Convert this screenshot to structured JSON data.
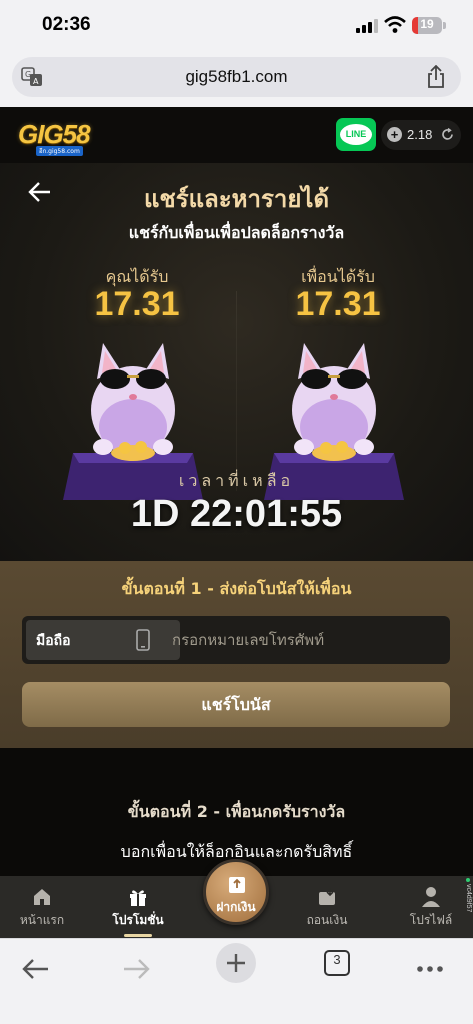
{
  "status_bar": {
    "time": "02:36",
    "battery": "19",
    "battery_level": 0.19
  },
  "browser": {
    "url": "gig58fb1.com",
    "tabs_count": "3"
  },
  "site": {
    "logo": "GIG58",
    "logo_sub": "อีก.gig58.com",
    "line_label": "LINE",
    "balance": "2.18"
  },
  "hero": {
    "title": "แชร์และหารายได้",
    "subtitle": "แชร์กับเพื่อนเพื่อปลดล็อกรางวัล",
    "you_label": "คุณได้รับ",
    "you_value": "17.31",
    "friend_label": "เพื่อนได้รับ",
    "friend_value": "17.31",
    "timer_label": "เวลาที่เหลือ",
    "timer": "1D 22:01:55"
  },
  "step1": {
    "title": "ขั้นตอนที่ 1 - ส่งต่อโบนัสให้เพื่อน",
    "phone_prefix": "มือถือ",
    "phone_placeholder": "กรอกหมายเลขโทรศัพท์",
    "share_button": "แชร์โบนัส"
  },
  "step2": {
    "title": "ขั้นตอนที่ 2 - เพื่อนกดรับรางวัล",
    "description": "บอกเพื่อนให้ล็อกอินและกดรับสิทธิ์"
  },
  "nav": {
    "home": "หน้าแรก",
    "promotions": "โปรโมชั่น",
    "deposit": "ฝากเงิน",
    "withdraw": "ถอนเงิน",
    "profile": "โปรไฟล์",
    "side_text": "vc4d9f57"
  },
  "colors": {
    "accent_gold": "#f6c343",
    "line_green": "#06c755",
    "brand_button": "#a58d64"
  }
}
